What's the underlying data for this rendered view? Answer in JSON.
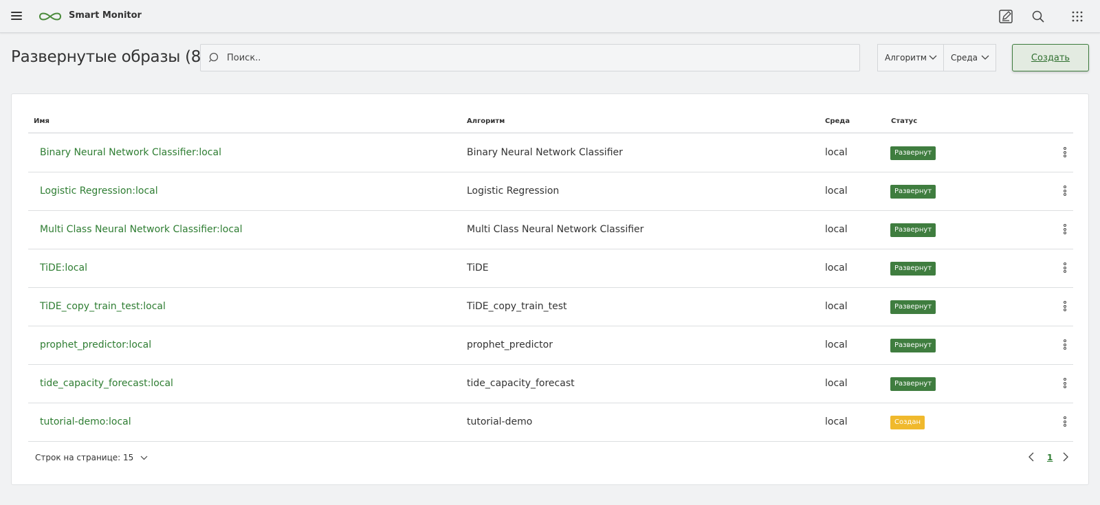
{
  "app": {
    "title": "Smart Monitor",
    "icons": [
      "menu-icon",
      "logo-icon",
      "edit-icon",
      "search-icon",
      "apps-grid-icon"
    ]
  },
  "header": {
    "page_title": "Развернутые образы (8)",
    "search_placeholder": "Поиск..",
    "filter_algorithm": "Алгоритм",
    "filter_environment": "Среда",
    "create_label": "Создать"
  },
  "table": {
    "columns": {
      "name": "Имя",
      "algorithm": "Алгоритм",
      "environment": "Среда",
      "status": "Статус"
    },
    "rows": [
      {
        "name": "Binary Neural Network Classifier:local",
        "algorithm": "Binary Neural Network Classifier",
        "environment": "local",
        "status": "Развернут",
        "status_kind": "deployed"
      },
      {
        "name": "Logistic Regression:local",
        "algorithm": "Logistic Regression",
        "environment": "local",
        "status": "Развернут",
        "status_kind": "deployed"
      },
      {
        "name": "Multi Class Neural Network Classifier:local",
        "algorithm": "Multi Class Neural Network Classifier",
        "environment": "local",
        "status": "Развернут",
        "status_kind": "deployed"
      },
      {
        "name": "TiDE:local",
        "algorithm": "TiDE",
        "environment": "local",
        "status": "Развернут",
        "status_kind": "deployed"
      },
      {
        "name": "TiDE_copy_train_test:local",
        "algorithm": "TiDE_copy_train_test",
        "environment": "local",
        "status": "Развернут",
        "status_kind": "deployed"
      },
      {
        "name": "prophet_predictor:local",
        "algorithm": "prophet_predictor",
        "environment": "local",
        "status": "Развернут",
        "status_kind": "deployed"
      },
      {
        "name": "tide_capacity_forecast:local",
        "algorithm": "tide_capacity_forecast",
        "environment": "local",
        "status": "Развернут",
        "status_kind": "deployed"
      },
      {
        "name": "tutorial-demo:local",
        "algorithm": "tutorial-demo",
        "environment": "local",
        "status": "Создан",
        "status_kind": "created"
      }
    ]
  },
  "pagination": {
    "rows_per_page_label": "Строк на странице: 15",
    "current_page": "1"
  },
  "colors": {
    "accent": "#2e7d32",
    "status_deployed": "#3f7d3f",
    "status_created": "#f0b92d",
    "background": "#f1f2f3"
  }
}
